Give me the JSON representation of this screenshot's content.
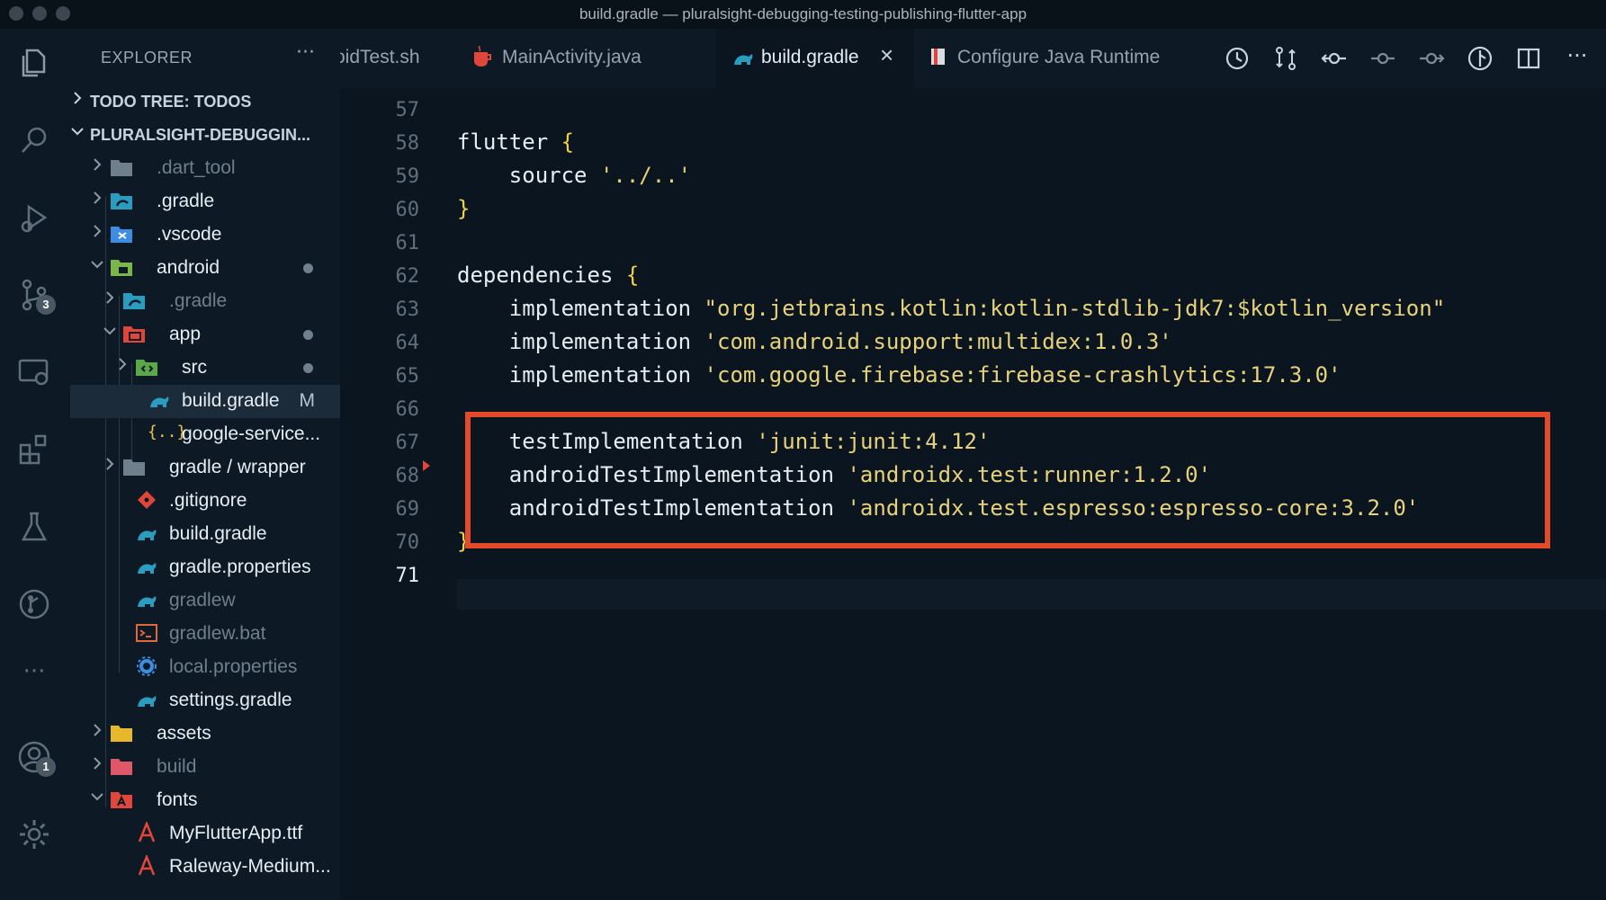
{
  "window": {
    "title": "build.gradle — pluralsight-debugging-testing-publishing-flutter-app"
  },
  "activity_bar": {
    "items": [
      {
        "icon": "files-icon"
      },
      {
        "icon": "search-icon"
      },
      {
        "icon": "run-debug-icon"
      },
      {
        "icon": "source-control-icon",
        "badge": "3"
      },
      {
        "icon": "remote-explorer-icon"
      },
      {
        "icon": "extensions-icon"
      },
      {
        "icon": "testing-icon"
      },
      {
        "icon": "git-graph-icon"
      },
      {
        "icon": "more-icon"
      },
      {
        "icon": "accounts-icon",
        "badge": "1"
      },
      {
        "icon": "settings-gear-icon"
      }
    ]
  },
  "sidebar": {
    "header": "EXPLORER",
    "more": "···",
    "todo_section": "TODO TREE: TODOS",
    "project_section": "PLURALSIGHT-DEBUGGIN...",
    "items": [
      {
        "label": ".dart_tool"
      },
      {
        "label": ".gradle"
      },
      {
        "label": ".vscode"
      },
      {
        "label": "android"
      },
      {
        "label": ".gradle"
      },
      {
        "label": "app"
      },
      {
        "label": "src"
      },
      {
        "label": "build.gradle",
        "status": "M"
      },
      {
        "label": "google-service..."
      },
      {
        "label": "gradle / wrapper"
      },
      {
        "label": ".gitignore"
      },
      {
        "label": "build.gradle"
      },
      {
        "label": "gradle.properties"
      },
      {
        "label": "gradlew"
      },
      {
        "label": "gradlew.bat"
      },
      {
        "label": "local.properties"
      },
      {
        "label": "settings.gradle"
      },
      {
        "label": "assets"
      },
      {
        "label": "build"
      },
      {
        "label": "fonts"
      },
      {
        "label": "MyFlutterApp.ttf"
      },
      {
        "label": "Raleway-Medium..."
      }
    ]
  },
  "tabs": [
    {
      "label": "oidTest.sh"
    },
    {
      "label": "MainActivity.java"
    },
    {
      "label": "build.gradle",
      "active": true,
      "close": "×"
    },
    {
      "label": "Configure Java Runtime"
    }
  ],
  "editor": {
    "line_numbers": [
      "57",
      "58",
      "59",
      "60",
      "61",
      "62",
      "63",
      "64",
      "65",
      "66",
      "67",
      "68",
      "69",
      "70",
      "71"
    ],
    "current_line": "71",
    "code": {
      "l58_kw": "flutter ",
      "l58_brace": "{",
      "l59_kw": "    source ",
      "l59_str": "'../..'",
      "l60_brace": "}",
      "l62_kw": "dependencies ",
      "l62_brace": "{",
      "l63_kw": "    implementation ",
      "l63_str": "\"org.jetbrains.kotlin:kotlin-stdlib-jdk7:$kotlin_version\"",
      "l64_kw": "    implementation ",
      "l64_str": "'com.android.support:multidex:1.0.3'",
      "l65_kw": "    implementation ",
      "l65_str": "'com.google.firebase:firebase-crashlytics:17.3.0'",
      "l67_kw": "    testImplementation ",
      "l67_str": "'junit:junit:4.12'",
      "l68_kw": "    androidTestImplementation ",
      "l68_str": "'androidx.test:runner:1.2.0'",
      "l69_kw": "    androidTestImplementation ",
      "l69_str": "'androidx.test.espresso:espresso-core:3.2.0'",
      "l70_brace": "}"
    }
  },
  "colors": {
    "background": "#0b1520",
    "string": "#e7d27a",
    "brace": "#f0d24a",
    "highlight_box": "#e24a2a"
  }
}
